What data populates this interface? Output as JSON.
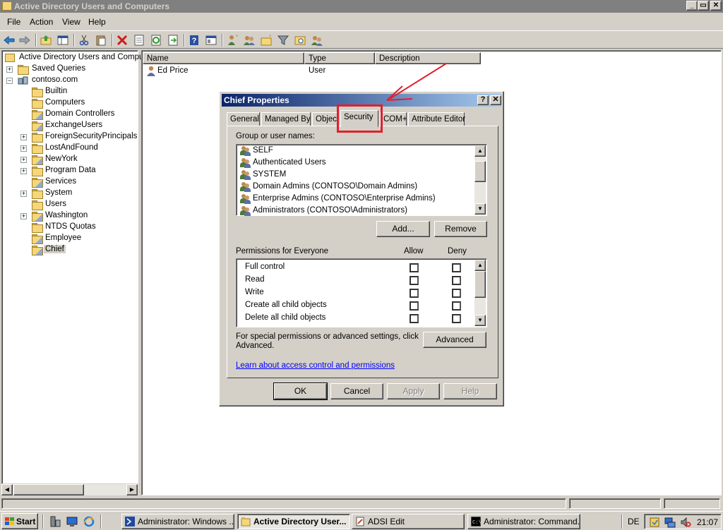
{
  "window": {
    "title": "Active Directory Users and Computers",
    "buttons": [
      "_",
      "▭",
      "✕"
    ]
  },
  "menu": [
    "File",
    "Action",
    "View",
    "Help"
  ],
  "toolbar_icons": [
    "back-icon",
    "forward-icon",
    "up-folder-icon",
    "show-hide-tree-icon",
    "cut-icon",
    "paste-icon",
    "delete-icon",
    "properties-icon",
    "refresh-icon",
    "export-icon",
    "help-icon",
    "console-icon",
    "new-user-icon",
    "new-group-icon",
    "new-ou-icon",
    "filter-icon",
    "find-icon",
    "add-to-group-icon"
  ],
  "tree": {
    "root": "Active Directory Users and Comput",
    "saved_queries": "Saved Queries",
    "domain": "contoso.com",
    "children": [
      {
        "label": "Builtin",
        "expandable": false,
        "ou": false
      },
      {
        "label": "Computers",
        "expandable": false,
        "ou": false
      },
      {
        "label": "Domain Controllers",
        "expandable": false,
        "ou": true
      },
      {
        "label": "ExchangeUsers",
        "expandable": false,
        "ou": true
      },
      {
        "label": "ForeignSecurityPrincipals",
        "expandable": true,
        "ou": false
      },
      {
        "label": "LostAndFound",
        "expandable": true,
        "ou": false
      },
      {
        "label": "NewYork",
        "expandable": true,
        "ou": true
      },
      {
        "label": "Program Data",
        "expandable": true,
        "ou": false
      },
      {
        "label": "Services",
        "expandable": false,
        "ou": true
      },
      {
        "label": "System",
        "expandable": true,
        "ou": false
      },
      {
        "label": "Users",
        "expandable": false,
        "ou": false
      },
      {
        "label": "Washington",
        "expandable": true,
        "ou": true
      },
      {
        "label": "NTDS Quotas",
        "expandable": false,
        "ou": false
      },
      {
        "label": "Employee",
        "expandable": false,
        "ou": true
      },
      {
        "label": "Chief",
        "expandable": false,
        "ou": true,
        "selected": true
      }
    ]
  },
  "list": {
    "columns": [
      "Name",
      "Type",
      "Description"
    ],
    "rows": [
      {
        "name": "Ed Price",
        "type": "User",
        "description": ""
      }
    ]
  },
  "dialog": {
    "title": "Chief Properties",
    "title_buttons": [
      "?",
      "✕"
    ],
    "tabs": [
      "General",
      "Managed By",
      "Object",
      "Security",
      "COM+",
      "Attribute Editor"
    ],
    "active_tab": "Security",
    "group_label": "Group or user names:",
    "principals": [
      "SELF",
      "Authenticated Users",
      "SYSTEM",
      "Domain Admins (CONTOSO\\Domain Admins)",
      "Enterprise Admins (CONTOSO\\Enterprise Admins)",
      "Administrators (CONTOSO\\Administrators)"
    ],
    "add_button": "Add...",
    "remove_button": "Remove",
    "permissions_label": "Permissions for Everyone",
    "allow_header": "Allow",
    "deny_header": "Deny",
    "permissions": [
      {
        "name": "Full control",
        "allow": false,
        "deny": false
      },
      {
        "name": "Read",
        "allow": false,
        "deny": false
      },
      {
        "name": "Write",
        "allow": false,
        "deny": false
      },
      {
        "name": "Create all child objects",
        "allow": false,
        "deny": false
      },
      {
        "name": "Delete all child objects",
        "allow": false,
        "deny": false
      }
    ],
    "advanced_text_line1": "For special permissions or advanced settings, click",
    "advanced_text_line2": "Advanced.",
    "advanced_button": "Advanced",
    "learn_link": "Learn about access control and permissions",
    "ok_button": "OK",
    "cancel_button": "Cancel",
    "apply_button": "Apply",
    "help_button": "Help"
  },
  "taskbar": {
    "start": "Start",
    "tasks": [
      {
        "label": "Administrator: Windows ...",
        "icon": "powershell-icon",
        "active": false
      },
      {
        "label": "Active Directory User...",
        "icon": "ad-icon",
        "active": true
      },
      {
        "label": "ADSI Edit",
        "icon": "adsi-icon",
        "active": false
      },
      {
        "label": "Administrator: Command...",
        "icon": "cmd-icon",
        "active": false
      }
    ],
    "language": "DE",
    "clock": "21:07"
  },
  "colors": {
    "annotation": "#e0202c",
    "dialog_title_start": "#0a246a",
    "dialog_title_end": "#a6caf0",
    "link": "#0000ff"
  }
}
